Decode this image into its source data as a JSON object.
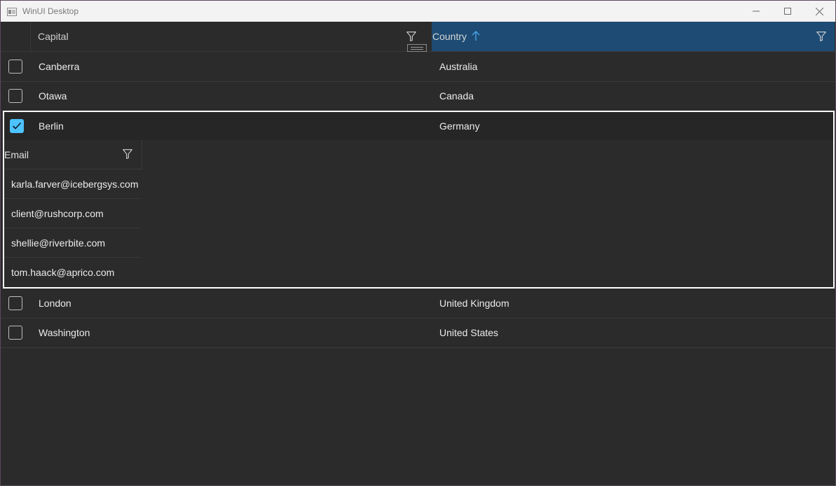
{
  "window": {
    "title": "WinUI Desktop"
  },
  "grid": {
    "columns": {
      "capital": "Capital",
      "country": "Country"
    },
    "sort_direction": "ascending",
    "rows": [
      {
        "capital": "Canberra",
        "country": "Australia",
        "checked": false
      },
      {
        "capital": "Otawa",
        "country": "Canada",
        "checked": false
      },
      {
        "capital": "Berlin",
        "country": "Germany",
        "checked": true
      },
      {
        "capital": "London",
        "country": "United Kingdom",
        "checked": false
      },
      {
        "capital": "Washington",
        "country": "United States",
        "checked": false
      }
    ],
    "details": {
      "column": "Email",
      "emails": [
        "karla.farver@icebergsys.com",
        "client@rushcorp.com",
        "shellie@riverbite.com",
        "tom.haack@aprico.com"
      ]
    }
  },
  "colors": {
    "accent": "#4cc2ff",
    "sorted_header": "#1d4b73",
    "background": "#2b2b2b"
  }
}
